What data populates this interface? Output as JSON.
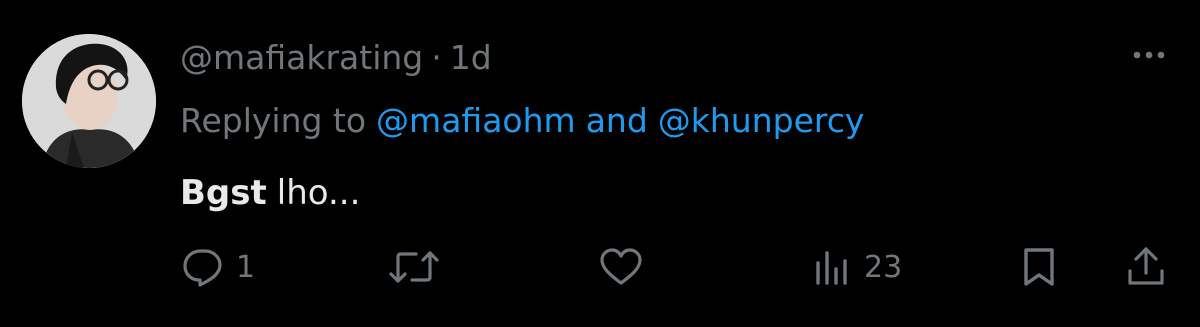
{
  "tweet": {
    "handle": "@mafiakrating",
    "separator": "·",
    "time_ago": "1d",
    "replying_prefix": "Replying to",
    "reply_to": [
      "@mafiaohm",
      "@khunpercy"
    ],
    "reply_joiner": "and",
    "text_bold": "Bgst",
    "text_rest": "lho..."
  },
  "actions": {
    "reply_count": "1",
    "retweet_count": "",
    "like_count": "",
    "views_count": "23"
  },
  "icons": {
    "more": "more-horizontal-icon",
    "reply": "reply-bubble-icon",
    "retweet": "retweet-icon",
    "like": "heart-icon",
    "views": "views-bar-chart-icon",
    "bookmark": "bookmark-icon",
    "share": "share-icon"
  },
  "colors": {
    "background": "#000000",
    "primary_text": "#e7e9ea",
    "secondary_text": "#71767b",
    "link": "#1d9bf0"
  }
}
